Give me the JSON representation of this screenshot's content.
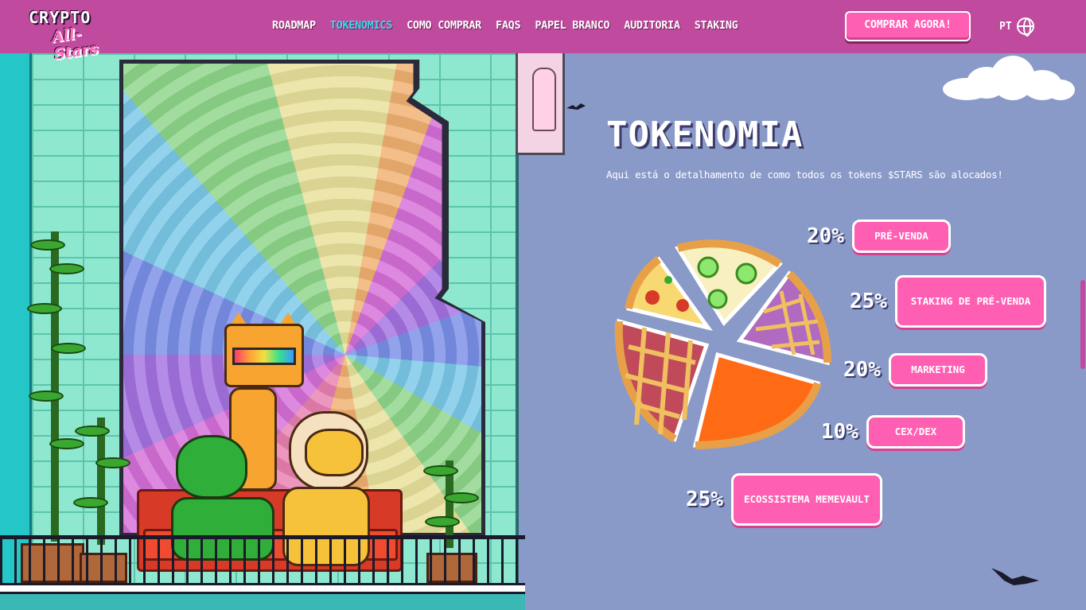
{
  "nav": {
    "logo_top": "CRYPTO",
    "logo_bottom": "All-Stars",
    "links": [
      {
        "label": "ROADMAP"
      },
      {
        "label": "TOKENOMICS"
      },
      {
        "label": "COMO COMPRAR"
      },
      {
        "label": "FAQS"
      },
      {
        "label": "PAPEL BRANCO"
      },
      {
        "label": "AUDITORIA"
      },
      {
        "label": "STAKING"
      }
    ],
    "active_link": "TOKENOMICS",
    "buy_button": "COMPRAR AGORA!",
    "language": "PT",
    "language_icon": "globe-icon"
  },
  "tokenomics": {
    "title": "TOKENOMIA",
    "subtitle": "Aqui está o detalhamento de como todos os tokens $STARS são alocados!",
    "allocations": [
      {
        "percent": "20%",
        "label": "PRÉ-VENDA",
        "value": 20
      },
      {
        "percent": "25%",
        "label": "STAKING DE PRÉ-VENDA",
        "value": 25
      },
      {
        "percent": "20%",
        "label": "MARKETING",
        "value": 20
      },
      {
        "percent": "10%",
        "label": "CEX/DEX",
        "value": 10
      },
      {
        "percent": "25%",
        "label": "ECOSSISTEMA MEMEVAULT",
        "value": 25
      }
    ]
  },
  "colors": {
    "nav_bg": "#c04a9e",
    "accent_pink": "#ff5fb2",
    "active_cyan": "#3fd8e8",
    "page_bg": "#8a9ac8"
  }
}
